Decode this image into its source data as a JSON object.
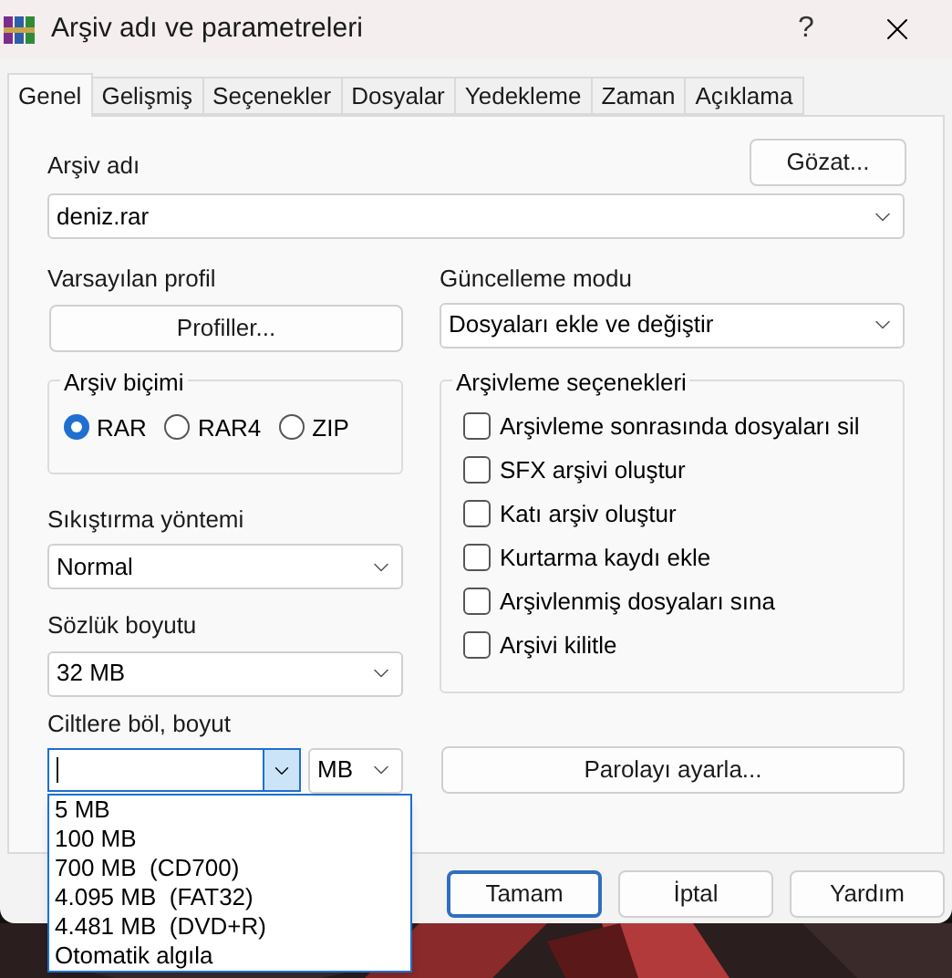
{
  "window": {
    "title": "Arşiv adı ve parametreleri",
    "help": "?"
  },
  "tabs": [
    {
      "label": "Genel",
      "selected": true
    },
    {
      "label": "Gelişmiş",
      "selected": false
    },
    {
      "label": "Seçenekler",
      "selected": false
    },
    {
      "label": "Dosyalar",
      "selected": false
    },
    {
      "label": "Yedekleme",
      "selected": false
    },
    {
      "label": "Zaman",
      "selected": false
    },
    {
      "label": "Açıklama",
      "selected": false
    }
  ],
  "archive_name": {
    "label": "Arşiv adı",
    "value": "deniz.rar",
    "browse_button": "Gözat..."
  },
  "profile": {
    "label": "Varsayılan profil",
    "button": "Profiller..."
  },
  "update_mode": {
    "label": "Güncelleme modu",
    "value": "Dosyaları ekle ve değiştir"
  },
  "archive_format": {
    "label": "Arşiv biçimi",
    "options": [
      {
        "label": "RAR",
        "selected": true
      },
      {
        "label": "RAR4",
        "selected": false
      },
      {
        "label": "ZIP",
        "selected": false
      }
    ]
  },
  "archiving_options": {
    "label": "Arşivleme seçenekleri",
    "items": [
      {
        "label": "Arşivleme sonrasında dosyaları sil",
        "checked": false
      },
      {
        "label": "SFX arşivi oluştur",
        "checked": false
      },
      {
        "label": "Katı arşiv oluştur",
        "checked": false
      },
      {
        "label": "Kurtarma kaydı ekle",
        "checked": false
      },
      {
        "label": "Arşivlenmiş dosyaları sına",
        "checked": false
      },
      {
        "label": "Arşivi kilitle",
        "checked": false
      }
    ]
  },
  "compression_method": {
    "label": "Sıkıştırma yöntemi",
    "value": "Normal"
  },
  "dictionary_size": {
    "label": "Sözlük boyutu",
    "value": "32 MB"
  },
  "split_volumes": {
    "label": "Ciltlere böl, boyut",
    "unit": "MB",
    "expanded": true,
    "options": [
      "5 MB",
      "100 MB",
      "700 MB  (CD700)",
      "4.095 MB  (FAT32)",
      "4.481 MB  (DVD+R)",
      "Otomatik algıla"
    ]
  },
  "password_button": "Parolayı ayarla...",
  "buttons": [
    {
      "label": "Tamam",
      "default": true
    },
    {
      "label": "İptal",
      "default": false
    },
    {
      "label": "Yardım",
      "default": false
    }
  ]
}
